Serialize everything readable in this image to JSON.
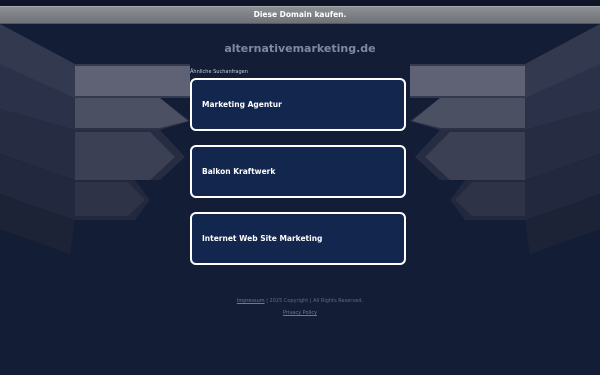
{
  "topbar": {
    "label": "Diese Domain kaufen."
  },
  "domain": "alternativemarketing.de",
  "related_label": "Ähnliche Suchanfragen",
  "links": [
    {
      "label": "Marketing Agentur"
    },
    {
      "label": "Balkon Kraftwerk"
    },
    {
      "label": "Internet Web Site Marketing"
    }
  ],
  "footer": {
    "imprint": "Impressum",
    "copyright": " | 2025 Copyright | All Rights Reserved.",
    "privacy": "Privacy Policy"
  },
  "colors": {
    "background": "#131d36",
    "card_fill": "#13264e",
    "card_border": "#ffffff"
  }
}
